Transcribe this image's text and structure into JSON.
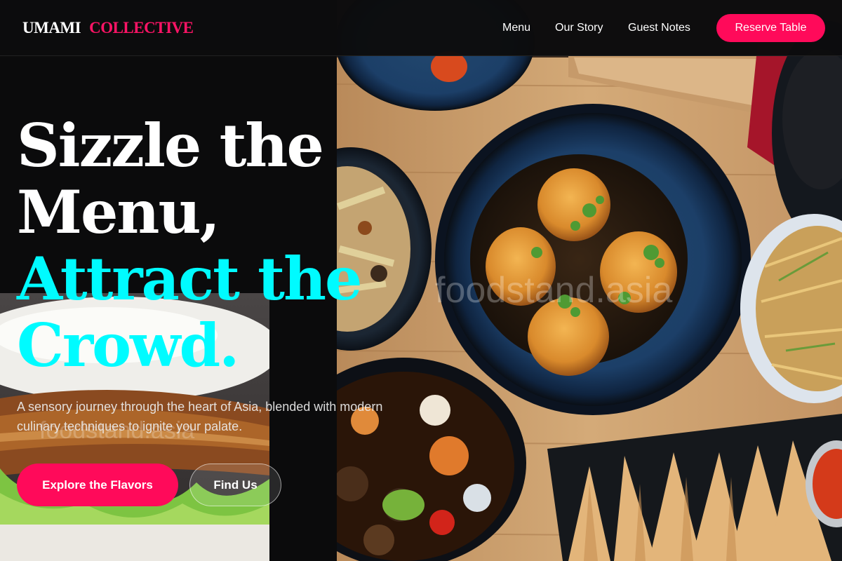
{
  "header": {
    "logo_word1": "UMAMI",
    "logo_word2": "COLLECTIVE",
    "nav": {
      "menu": "Menu",
      "story": "Our Story",
      "notes": "Guest Notes"
    },
    "reserve": "Reserve Table"
  },
  "hero": {
    "line1": "Sizzle the",
    "line2": "Menu,",
    "line3": "Attract the",
    "line4": "Crowd.",
    "subtitle": "A sensory journey through the heart of Asia, blended with modern culinary techniques to ignite your palate.",
    "cta_primary": "Explore the Flavors",
    "cta_secondary": "Find Us"
  },
  "watermarks": {
    "right": "foodstand.asia",
    "left": "foodstand.asia"
  },
  "colors": {
    "accent": "#ff0a5a",
    "highlight": "#00fbff",
    "background": "#0b0b0c"
  },
  "images": {
    "right": "asian-dishes-photo",
    "left": "bao-bun-photo"
  }
}
